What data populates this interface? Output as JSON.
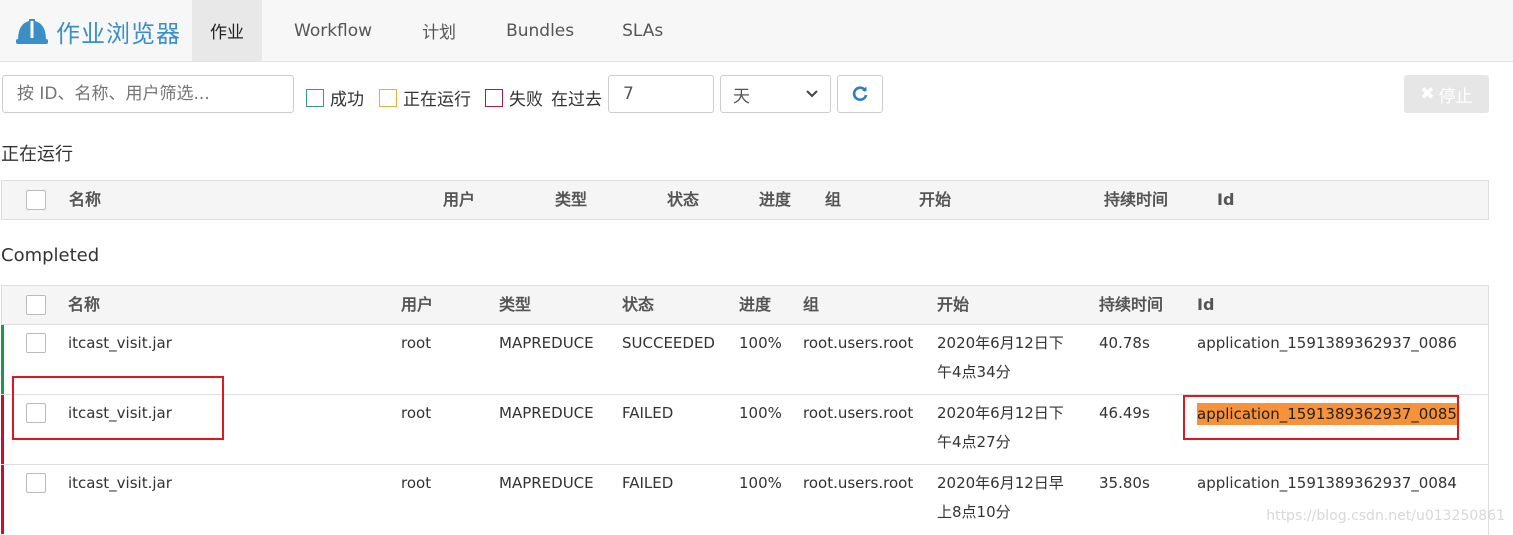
{
  "app": {
    "title": "作业浏览器",
    "logo_icon": "hard-hat-icon",
    "brand_color": "#3a8fc8"
  },
  "nav": [
    {
      "label": "作业",
      "active": true
    },
    {
      "label": "Workflow",
      "active": false
    },
    {
      "label": "计划",
      "active": false
    },
    {
      "label": "Bundles",
      "active": false
    },
    {
      "label": "SLAs",
      "active": false
    }
  ],
  "filters": {
    "search_placeholder": "按 ID、名称、用户筛选...",
    "succeeded_label": "成功",
    "running_label": "正在运行",
    "failed_label": "失败",
    "past_label": "在过去",
    "days_value": "7",
    "unit_value": "天",
    "stop_label": "停止",
    "succeeded_color": "#3a9a7a",
    "running_color": "#e0b040",
    "failed_color": "#a02040"
  },
  "running": {
    "title": "正在运行",
    "headers": [
      "名称",
      "用户",
      "类型",
      "状态",
      "进度",
      "组",
      "开始",
      "持续时间",
      "Id"
    ]
  },
  "completed": {
    "title": "Completed",
    "headers": [
      "名称",
      "用户",
      "类型",
      "状态",
      "进度",
      "组",
      "开始",
      "持续时间",
      "Id"
    ],
    "rows": [
      {
        "name": "itcast_visit.jar",
        "user": "root",
        "type": "MAPREDUCE",
        "status": "SUCCEEDED",
        "progress": "100%",
        "group": "root.users.root",
        "start_line1": "2020年6月12日下",
        "start_line2": "午4点34分",
        "duration": "40.78s",
        "id": "application_1591389362937_0086",
        "status_color": "#1a9a4a"
      },
      {
        "name": "itcast_visit.jar",
        "user": "root",
        "type": "MAPREDUCE",
        "status": "FAILED",
        "progress": "100%",
        "group": "root.users.root",
        "start_line1": "2020年6月12日下",
        "start_line2": "午4点27分",
        "duration": "46.49s",
        "id": "application_1591389362937_0085",
        "status_color": "#c8102e"
      },
      {
        "name": "itcast_visit.jar",
        "user": "root",
        "type": "MAPREDUCE",
        "status": "FAILED",
        "progress": "100%",
        "group": "root.users.root",
        "start_line1": "2020年6月12日早",
        "start_line2": "上8点10分",
        "duration": "35.80s",
        "id": "application_1591389362937_0084",
        "status_color": "#c8102e"
      }
    ]
  },
  "watermark": "https://blog.csdn.net/u013250861"
}
